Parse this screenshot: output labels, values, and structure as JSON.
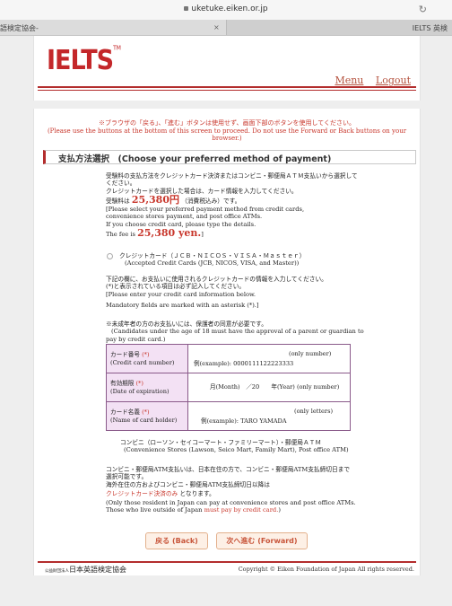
{
  "browser": {
    "url": "uketuke.eiken.or.jp",
    "tab_left": "語検定協会-",
    "tab_right": "IELTS 英検",
    "tab_close": "×",
    "reload_icon": "↻"
  },
  "header": {
    "logo": "IELTS",
    "logo_tm": "TM",
    "nav": [
      "Menu",
      "Logout"
    ]
  },
  "warning": {
    "jp": "※ブラウザの「戻る」、「進む」ボタンは使用せず、画面下部のボタンを使用してください。",
    "en1": "(Please use the buttons at the bottom of this screen to proceed. Do not use the Forward or Back buttons on your",
    "en2": "browser.)"
  },
  "section_title": "支払方法選択　(Choose your preferred method of payment)",
  "intro": {
    "l1": "受験料の支払方法をクレジットカード決済またはコンビニ・郵便局ＡＴＭ支払いから選択して",
    "l2": "ください。",
    "l3": "クレジットカードを選択した場合は、カード情報を入力してください。",
    "fee_jp_pre": "受験料は",
    "fee_amount_jp": "25,380円",
    "fee_jp_post": "（消費税込み）です。",
    "l5": "[Please select your preferred payment method from credit cards,",
    "l6": "convenience stores payment, and post office ATMs.",
    "l7": "If you choose credit card, please type the details.",
    "fee_en_pre": "The fee is",
    "fee_amount_en": "25,380 yen.",
    "fee_en_post": "]"
  },
  "credit_option": {
    "jp": "クレジットカード（ＪＣＢ・ＮＩＣＯＳ・ＶＩＳＡ・Ｍａｓｔｅｒ）",
    "en": "(Accepted Credit Cards (JCB, NICOS, VISA, and Master))"
  },
  "card_instructions": {
    "l1": "下記の欄に、お支払いに使用されるクレジットカードの情報を入力してください。",
    "l2": "(*)と表示されている項目は必ず記入してください。",
    "l3": "[Please enter your credit card information below.",
    "l4": "Mandatory fields are marked with an asterisk   (*).]"
  },
  "minor_note": {
    "jp": "※未成年者の方のお支払いには、保護者の同意が必要です。",
    "en1": "(Candidates under the age of 18 must have the approval of a parent or guardian to",
    "en2": "pay by credit card.)"
  },
  "form": {
    "card_number": {
      "label_jp": "カード番号",
      "label_en": "(Credit card number)",
      "note": "(only number)",
      "example": "例(example): 0000111122223333"
    },
    "expiration": {
      "label_jp": "有効期限",
      "label_en": "(Date of expiration)",
      "text": "月(Month)　／20　　年(Year)  (only number)"
    },
    "card_holder": {
      "label_jp": "カード名義",
      "label_en": "(Name of card holder)",
      "note": "(only letters)",
      "example": "例(example): TARO YAMADA"
    },
    "required_mark": "(*)"
  },
  "convenience_option": {
    "jp": "コンビニ（ローソン・セイコーマート・ファミリーマート）・郵便局ＡＴＭ",
    "en": "(Convenience Stores (Lawson, Seico Mart, Family Mart), Post office ATM)"
  },
  "convenience_note": {
    "l1": "コンビニ・郵便局ATM支払いは、日本在住の方で、コンビニ・郵便局ATM支払締切日まで",
    "l2": "選択可能です。",
    "l3": "海外在住の方およびコンビニ・郵便局ATM支払締切日以降は",
    "l4_red": "クレジットカード決済のみ",
    "l4_post": "となります。",
    "l5": "(Only those resident in Japan can pay at convenience stores and post office ATMs.",
    "l6_pre": "Those who live outside of Japan",
    "l6_red": "must pay by credit card.",
    "l6_post": ")"
  },
  "buttons": {
    "back": "戻る (Back)",
    "forward": "次へ進む (Forward)"
  },
  "footer": {
    "org_small": "公益財団法人",
    "org": "日本英語検定協会",
    "copyright": "Copyright © Eiken Foundation of Japan All rights reserved."
  },
  "colors": {
    "accent": "#c4272a",
    "line": "#b32d2d",
    "table_label_bg": "#f3e1f4"
  }
}
